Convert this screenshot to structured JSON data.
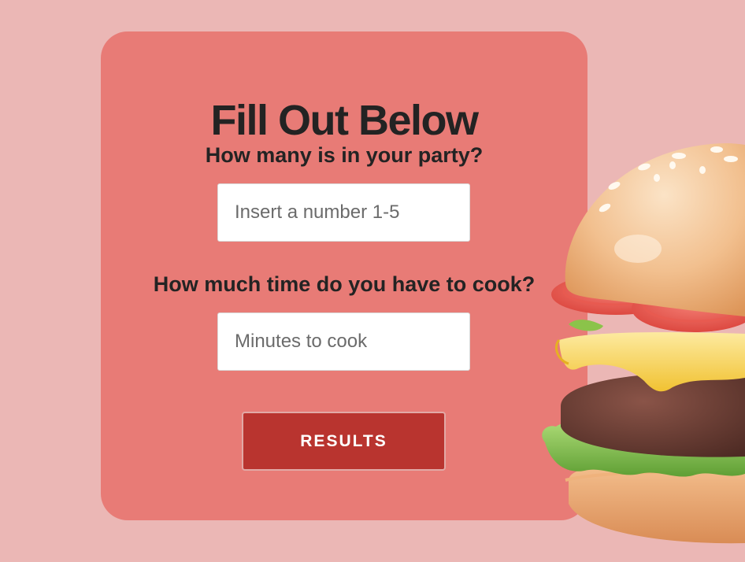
{
  "form": {
    "title": "Fill Out Below",
    "party_question": "How many is in your party?",
    "party_placeholder": "Insert a number 1-5",
    "time_question": "How much time do you have to cook?",
    "time_placeholder": "Minutes to cook",
    "submit_label": "RESULTS"
  },
  "colors": {
    "page_background": "#ebb7b5",
    "card_background": "#e87b76",
    "button_background": "#b9342f",
    "text": "#232323"
  },
  "decoration": {
    "burger_image": "burger-illustration"
  }
}
